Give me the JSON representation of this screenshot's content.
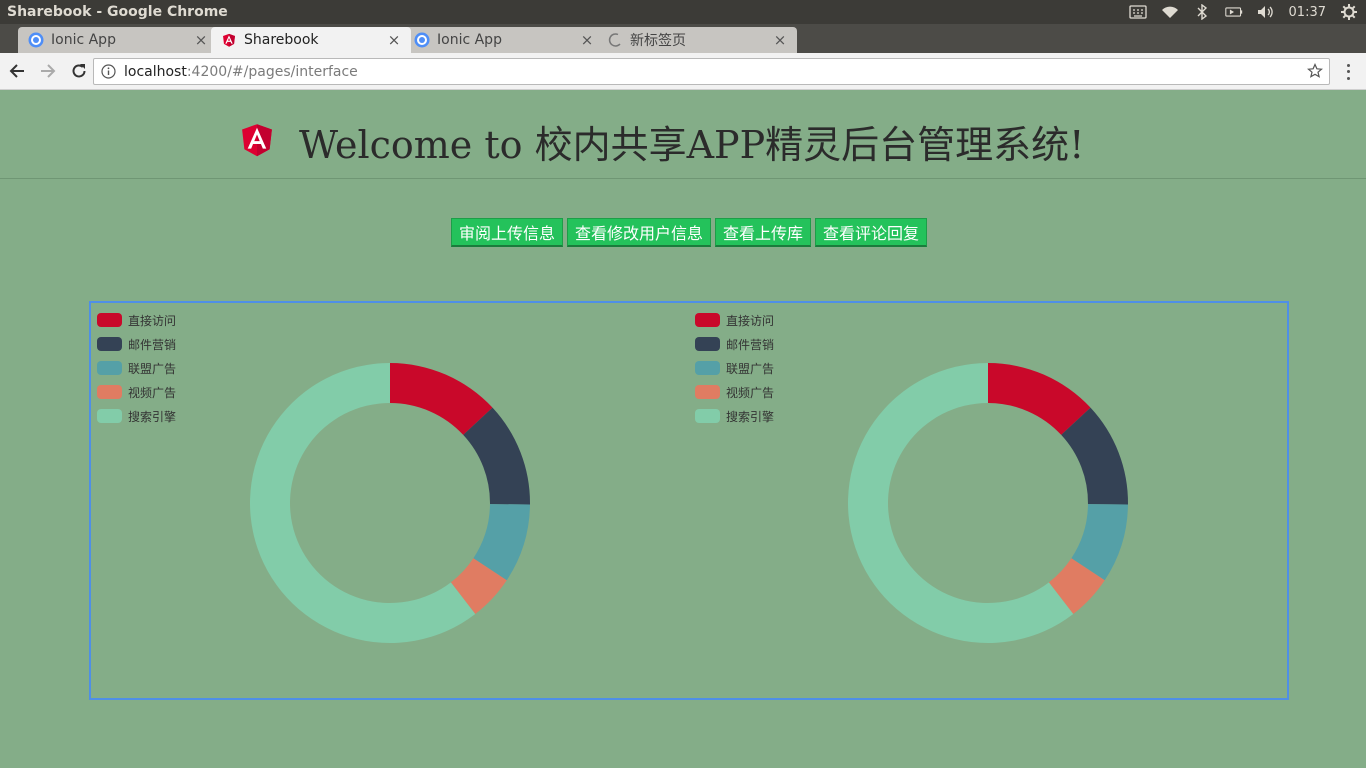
{
  "window": {
    "title": "Sharebook - Google Chrome",
    "clock": "01:37"
  },
  "tabs": [
    {
      "title": "Ionic App",
      "favicon": "ionic-icon",
      "active": false
    },
    {
      "title": "Sharebook",
      "favicon": "angular-icon",
      "active": true
    },
    {
      "title": "Ionic App",
      "favicon": "ionic-icon",
      "active": false
    },
    {
      "title": "新标签页",
      "favicon": "loading-spinner-icon",
      "active": false
    }
  ],
  "tab_close_glyph": "×",
  "address": {
    "host": "localhost",
    "rest": ":4200/#/pages/interface"
  },
  "header": {
    "title": "Welcome to 校内共享APP精灵后台管理系统!"
  },
  "nav_buttons": [
    "审阅上传信息",
    "查看修改用户信息",
    "查看上传库",
    "查看评论回复"
  ],
  "colors": {
    "page_bg": "#84ad88",
    "button_green": "#24c25b",
    "chart_border": "#4f8fe6",
    "series": [
      "#c9082a",
      "#344255",
      "#55a0a7",
      "#e07c62",
      "#82cca9"
    ]
  },
  "chart_data": [
    {
      "type": "pie",
      "donut": true,
      "legend_position": "top-left",
      "categories": [
        "直接访问",
        "邮件营销",
        "联盟广告",
        "视频广告",
        "搜索引擎"
      ],
      "values": [
        335,
        310,
        234,
        135,
        1548
      ]
    },
    {
      "type": "pie",
      "donut": true,
      "legend_position": "top-left",
      "categories": [
        "直接访问",
        "邮件营销",
        "联盟广告",
        "视频广告",
        "搜索引擎"
      ],
      "values": [
        335,
        310,
        234,
        135,
        1548
      ]
    }
  ]
}
